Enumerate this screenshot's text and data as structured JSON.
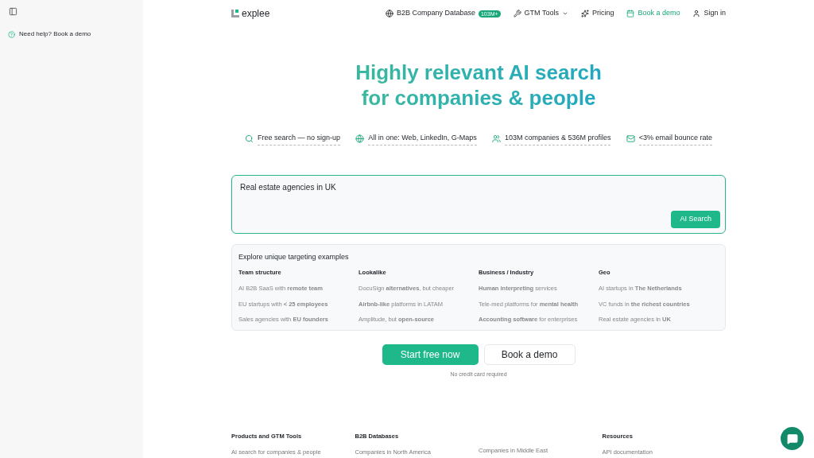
{
  "sidebar": {
    "help_link": "Need help? Book a demo"
  },
  "nav": {
    "logo": "explee",
    "items": [
      {
        "kind": "database",
        "label": "B2B Company Database",
        "badge": "103M+"
      },
      {
        "kind": "dropdown",
        "label": "GTM Tools"
      },
      {
        "kind": "pricing",
        "label": "Pricing"
      },
      {
        "kind": "demo",
        "label": "Book a demo"
      },
      {
        "kind": "signin",
        "label": "Sign in"
      }
    ]
  },
  "hero": {
    "title_lines": [
      "Highly relevant AI search",
      "for companies & people"
    ]
  },
  "features": [
    {
      "kind": "search",
      "label": "Free search — no sign-up"
    },
    {
      "kind": "globe",
      "label": "All in one: Web, LinkedIn, G-Maps"
    },
    {
      "kind": "users",
      "label": "103M companies & 536M profiles"
    },
    {
      "kind": "mail",
      "label": "<3% email bounce rate"
    }
  ],
  "search": {
    "value": "Real estate agencies in UK",
    "button": "AI Search"
  },
  "examples": {
    "title": "Explore unique targeting examples",
    "columns": [
      {
        "heading": "Team structure",
        "items": [
          "AI B2B SaaS with **remote team**",
          "EU startups with **< 25 employees**",
          "Sales agencies with **EU founders**"
        ]
      },
      {
        "heading": "Lookalike",
        "items": [
          "DocuSign **alternatives**, but cheaper",
          "**Airbnb-like** platforms in LATAM",
          "Amplitude, but **open-source**"
        ]
      },
      {
        "heading": "Business / Industry",
        "items": [
          "**Human interpreting** services",
          "Tele-med platforms for **mental health**",
          "**Accounting software** for enterprises"
        ]
      },
      {
        "heading": "Geo",
        "items": [
          "AI startups in **The Netherlands**",
          "VC funds in **the richest countries**",
          "Real estate agencies in **UK**"
        ]
      }
    ]
  },
  "cta": {
    "primary": "Start free now",
    "secondary": "Book a demo",
    "note": "No credit card required"
  },
  "footer": {
    "columns": [
      {
        "heading": "Products and GTM Tools",
        "links": [
          "AI search for companies & people"
        ]
      },
      {
        "heading": "B2B Databases",
        "links": [
          "Companies in North America"
        ]
      },
      {
        "links": [
          "Companies in Middle East"
        ]
      },
      {
        "heading": "Resources",
        "links": [
          "API documentation"
        ]
      }
    ]
  }
}
